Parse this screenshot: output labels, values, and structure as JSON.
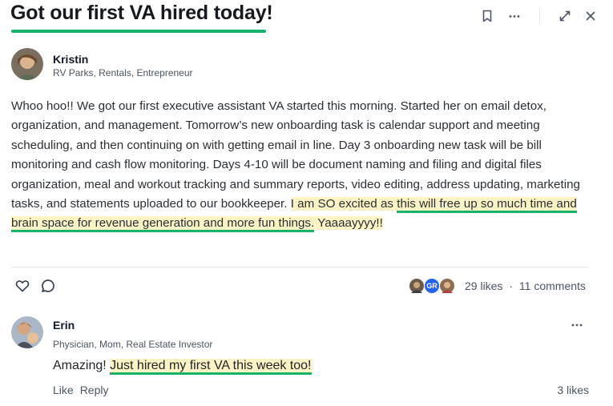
{
  "post": {
    "title": "Got our first VA hired today!",
    "author": {
      "name": "Kristin",
      "subtitle": "RV Parks, Rentals, Entrepreneur"
    },
    "body": {
      "part1": "Whoo hoo!! We got our first executive assistant VA started this morning. Started her on email detox, organization, and management. Tomorrow’s new onboarding task is calendar support and meeting scheduling, and then continuing on with getting email in line. Day 3 onboarding new task will be bill monitoring and cash flow monitoring. Days 4-10 will be document naming and filing and digital files organization, meal and workout tracking and summary reports, video editing, address updating, marketing tasks, and statements uploaded to our bookkeeper. ",
      "hl1": "I am SO excited as ",
      "hl2": "this will free up so much time and brain space for revenue generation and more fun things.",
      "hl3": " Yaaaayyyy!!"
    },
    "likes": "29 likes",
    "separator": "·",
    "comments_count": "11 comments",
    "liker_initials": "GR"
  },
  "comment": {
    "author": {
      "name": "Erin",
      "subtitle": "Physician, Mom, Real Estate Investor"
    },
    "text_plain": "Amazing! ",
    "text_highlight": "Just hired my first VA this week too!",
    "like_label": "Like",
    "reply_label": "Reply",
    "likes": "3 likes"
  },
  "icons": {
    "bookmark": "bookmark-icon",
    "more": "more-icon",
    "expand": "expand-icon",
    "close": "close-icon",
    "heart": "heart-icon",
    "comment": "comment-icon"
  },
  "colors": {
    "accent_underline": "#17b26a",
    "highlight": "#fdf3c4",
    "liker_badge": "#2563eb"
  }
}
